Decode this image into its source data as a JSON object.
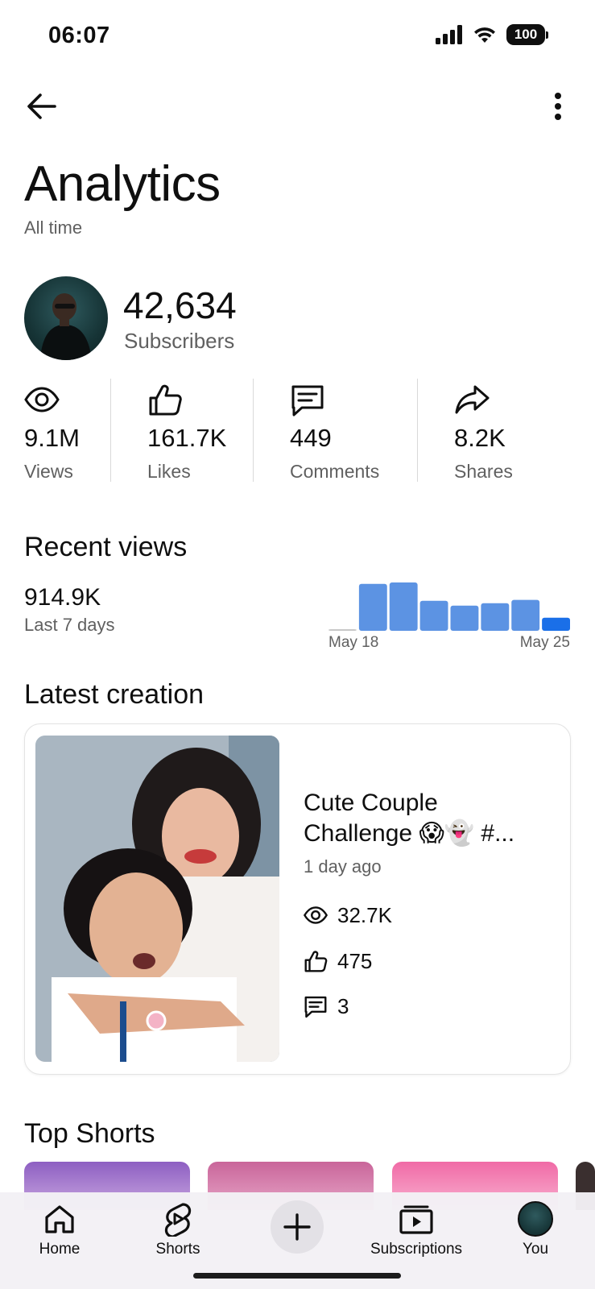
{
  "status_bar": {
    "time": "06:07",
    "battery": "100"
  },
  "header": {
    "title": "Analytics",
    "subtitle": "All time"
  },
  "channel": {
    "subscribers_value": "42,634",
    "subscribers_label": "Subscribers"
  },
  "stats": [
    {
      "value": "9.1M",
      "label": "Views",
      "icon": "eye-icon"
    },
    {
      "value": "161.7K",
      "label": "Likes",
      "icon": "thumbs-up-icon"
    },
    {
      "value": "449",
      "label": "Comments",
      "icon": "comment-icon"
    },
    {
      "value": "8.2K",
      "label": "Shares",
      "icon": "share-icon"
    }
  ],
  "recent_views": {
    "title": "Recent views",
    "value": "914.9K",
    "period": "Last 7 days",
    "start_label": "May 18",
    "end_label": "May 25"
  },
  "chart_data": {
    "type": "bar",
    "categories": [
      "",
      "",
      "",
      "",
      "",
      "",
      "",
      ""
    ],
    "values": [
      0.02,
      0.97,
      1.0,
      0.62,
      0.52,
      0.57,
      0.64,
      0.27
    ],
    "x_tick_labels": [
      "May 18",
      "May 25"
    ],
    "colors": {
      "bar": "#5c93e3",
      "current": "#1a6fe8",
      "baseline": "#c8c8c8"
    }
  },
  "latest_creation": {
    "title": "Latest creation",
    "video_title": "Cute Couple Challenge 😱👻 #...",
    "age": "1 day ago",
    "views": "32.7K",
    "likes": "475",
    "comments": "3"
  },
  "top_shorts": {
    "title": "Top Shorts"
  },
  "nav": {
    "home": "Home",
    "shorts": "Shorts",
    "subscriptions": "Subscriptions",
    "you": "You"
  }
}
